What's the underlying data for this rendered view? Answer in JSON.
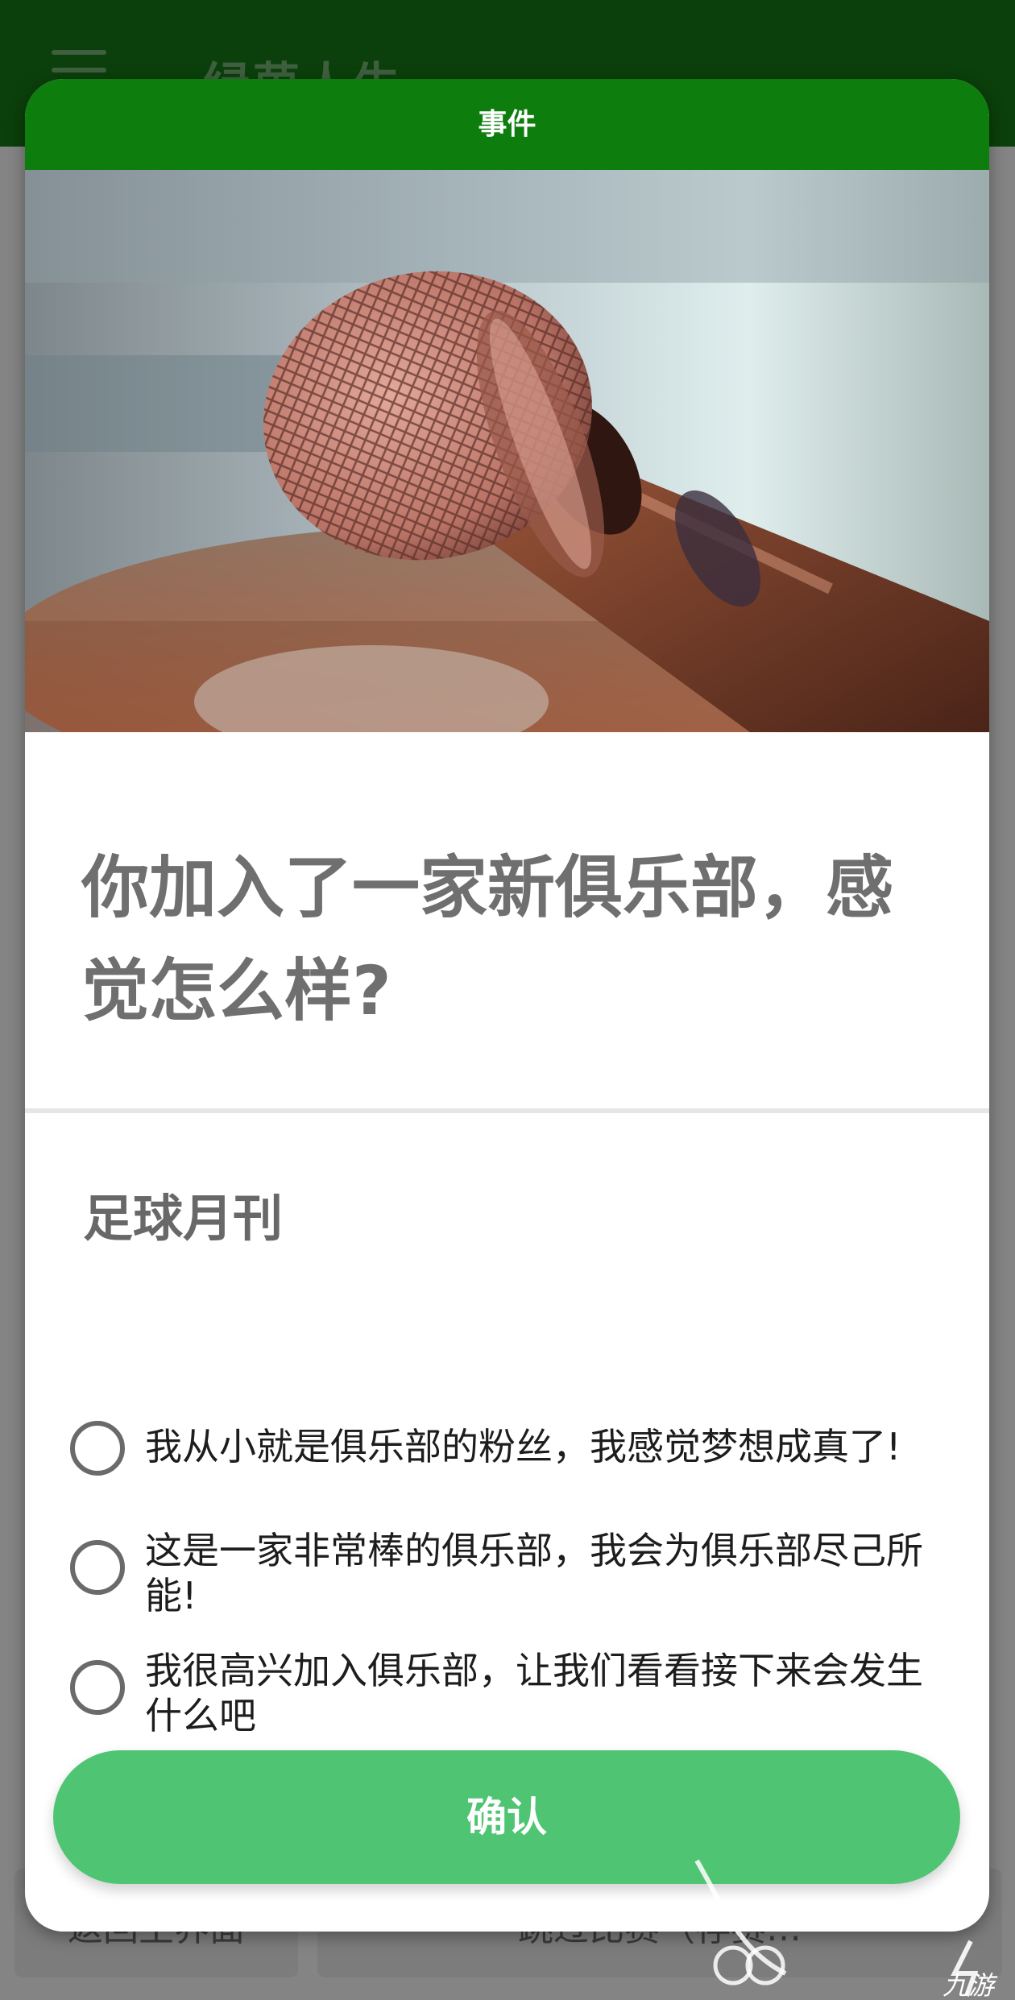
{
  "app": {
    "title": "绿茵人生"
  },
  "background": {
    "left_button": "返回主界面",
    "right_button": "跳过比赛（存赛…"
  },
  "dialog": {
    "header": "事件",
    "question": "你加入了一家新俱乐部，感觉怎么样?",
    "source": "足球月刊",
    "options": [
      {
        "label": "我从小就是俱乐部的粉丝，我感觉梦想成真了!",
        "selected": false
      },
      {
        "label": "这是一家非常棒的俱乐部，我会为俱乐部尽己所能!",
        "selected": false
      },
      {
        "label": "我很高兴加入俱乐部，让我们看看接下来会发生什么吧",
        "selected": false
      }
    ],
    "confirm_label": "确认"
  },
  "watermark": {
    "text": "九游"
  },
  "colors": {
    "header_green": "#0d7d0d",
    "confirm_green": "#4fc573",
    "app_bar": "#0b3f0b"
  }
}
